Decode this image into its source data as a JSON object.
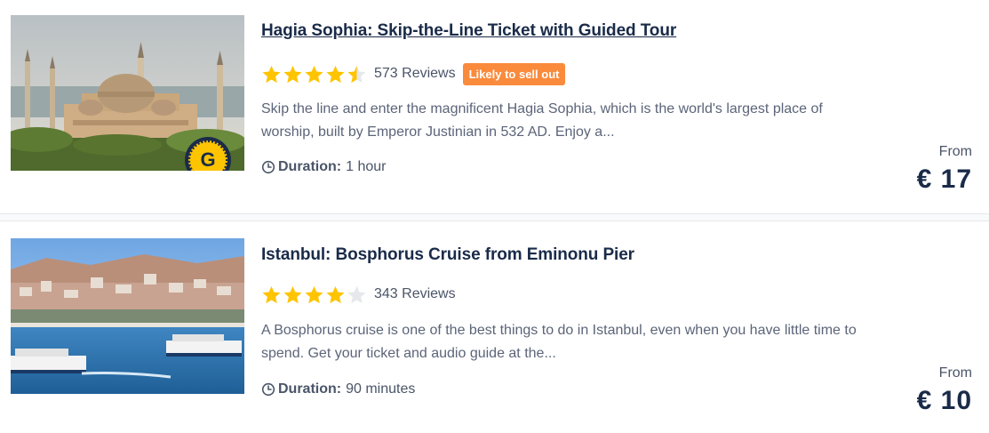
{
  "tours": [
    {
      "title": "Hagia Sophia: Skip-the-Line Ticket with Guided Tour",
      "rating": 4.5,
      "reviews": "573 Reviews",
      "badge": "Likely to sell out",
      "description_line1": "Skip the line and enter the magnificent Hagia Sophia, which is the world's largest place of",
      "description_line2": "worship, built by Emperor Justinian in 532 AD. Enjoy a...",
      "duration_label": "Duration:",
      "duration_value": "1 hour",
      "from_label": "From",
      "price": "€ 17",
      "badge_icon": "G"
    },
    {
      "title": "Istanbul: Bosphorus Cruise from Eminonu Pier",
      "rating": 4,
      "reviews": "343 Reviews",
      "description_line1": "A Bosphorus cruise is one of the best things to do in Istanbul, even when you have little time to",
      "description_line2": "spend. Get your ticket and audio guide at the...",
      "duration_label": "Duration:",
      "duration_value": "90 minutes",
      "from_label": "From",
      "price": "€ 10"
    }
  ],
  "colors": {
    "star": "#ffc400",
    "star_empty": "#e6e8ec",
    "badge": "#fa8b3c",
    "title": "#1a2b49"
  }
}
